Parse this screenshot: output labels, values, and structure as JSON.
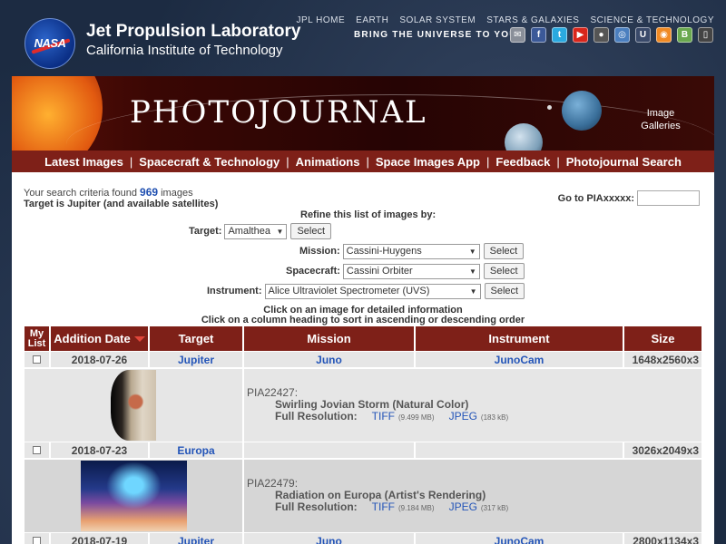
{
  "header": {
    "org_title": "Jet Propulsion Laboratory",
    "org_subtitle": "California Institute of Technology",
    "nasa_logo_text": "NASA",
    "top_nav": [
      "JPL HOME",
      "EARTH",
      "SOLAR SYSTEM",
      "STARS & GALAXIES",
      "SCIENCE & TECHNOLOGY"
    ],
    "bring_universe": "BRING THE UNIVERSE TO YOU:",
    "social_icons": [
      {
        "name": "email-icon",
        "glyph": "✉",
        "color": "#8a8f99"
      },
      {
        "name": "facebook-icon",
        "glyph": "f",
        "color": "#3b5998"
      },
      {
        "name": "twitter-icon",
        "glyph": "t",
        "color": "#2aa9e0"
      },
      {
        "name": "youtube-icon",
        "glyph": "▶",
        "color": "#d9261c"
      },
      {
        "name": "flickr-icon",
        "glyph": "●",
        "color": "#555555"
      },
      {
        "name": "podcast-icon",
        "glyph": "◎",
        "color": "#4b7fbf"
      },
      {
        "name": "ustream-icon",
        "glyph": "U",
        "color": "#3a4a6a"
      },
      {
        "name": "rss-icon",
        "glyph": "◉",
        "color": "#f08a24"
      },
      {
        "name": "blog-icon",
        "glyph": "B",
        "color": "#6aa84f"
      },
      {
        "name": "mobile-icon",
        "glyph": "▯",
        "color": "#444444"
      }
    ]
  },
  "banner": {
    "title": "PHOTOJOURNAL",
    "image_galleries": "Image Galleries"
  },
  "main_nav": [
    "Latest Images",
    "Spacecraft & Technology",
    "Animations",
    "Space Images App",
    "Feedback",
    "Photojournal Search"
  ],
  "search": {
    "prefix": "Your search criteria found",
    "count": "969",
    "suffix": "images",
    "target_line": "Target is Jupiter (and available satellites)",
    "goto_label": "Go to PIAxxxxx:",
    "goto_value": ""
  },
  "refine": {
    "title": "Refine this list of images by:",
    "select_button": "Select",
    "filters": [
      {
        "label": "Target:",
        "value": "Amalthea"
      },
      {
        "label": "Mission:",
        "value": "Cassini-Huygens"
      },
      {
        "label": "Spacecraft:",
        "value": "Cassini Orbiter"
      },
      {
        "label": "Instrument:",
        "value": "Alice Ultraviolet Spectrometer (UVS)"
      }
    ]
  },
  "instructions": {
    "line1": "Click on an image for detailed information",
    "line2": "Click on a column heading to sort in ascending or descending order"
  },
  "table": {
    "headers": {
      "mylist_1": "My",
      "mylist_2": "List",
      "date": "Addition Date",
      "target": "Target",
      "mission": "Mission",
      "instrument": "Instrument",
      "size": "Size"
    },
    "full_res_label": "Full Resolution:",
    "rows": [
      {
        "date": "2018-07-26",
        "target": "Jupiter",
        "mission": "Juno",
        "instrument": "JunoCam",
        "size": "1648x2560x3",
        "pia": "PIA22427:",
        "title": "Swirling Jovian Storm (Natural Color)",
        "tiff": "TIFF",
        "tiff_size": "(9.499 MB)",
        "jpeg": "JPEG",
        "jpeg_size": "(183 kB)"
      },
      {
        "date": "2018-07-23",
        "target": "Europa",
        "mission": "",
        "instrument": "",
        "size": "3026x2049x3",
        "pia": "PIA22479:",
        "title": "Radiation on Europa (Artist's Rendering)",
        "tiff": "TIFF",
        "tiff_size": "(9.184 MB)",
        "jpeg": "JPEG",
        "jpeg_size": "(317 kB)"
      },
      {
        "date": "2018-07-19",
        "target": "Jupiter",
        "mission": "Juno",
        "instrument": "JunoCam",
        "size": "2800x1134x3"
      }
    ]
  }
}
